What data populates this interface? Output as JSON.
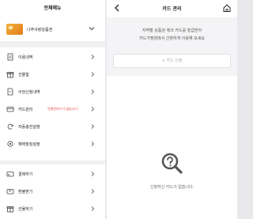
{
  "left_panel": {
    "title": "전체메뉴",
    "card": {
      "name": "나주사랑상품권"
    },
    "menu_group_1": [
      {
        "label": "이용내역",
        "icon": "receipt-icon"
      },
      {
        "label": "선물함",
        "icon": "gift-box-icon"
      },
      {
        "label": "수당신청내역",
        "icon": "document-icon"
      },
      {
        "label": "카드관리",
        "icon": "card-icon",
        "note": "연결된카드가 없습니다."
      },
      {
        "label": "자동충전설정",
        "icon": "auto-charge-icon"
      },
      {
        "label": "혜택놓침설정",
        "icon": "settings-icon"
      }
    ],
    "menu_group_2": [
      {
        "label": "결제하기",
        "icon": "payment-icon"
      },
      {
        "label": "환불받기",
        "icon": "refund-icon"
      },
      {
        "label": "선물하기",
        "icon": "gift-icon"
      }
    ]
  },
  "right_panel": {
    "title": "카드 관리",
    "description_line1": "지역별 상품권 체크 카드를 발급받아",
    "description_line2": "카드가맹점에서 간편하게 이용해 보세요",
    "add_card_button": "+ 카드 신청",
    "empty_message": "신청하신 카드가 없습니다."
  },
  "colors": {
    "card_orange": "#f3b03b",
    "notice_red": "#e23b3b",
    "panel_bg": "#f1f1f4"
  }
}
